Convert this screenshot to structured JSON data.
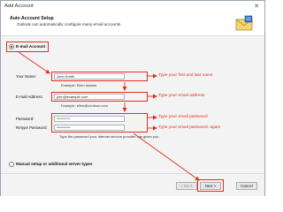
{
  "window": {
    "title": "Add Account",
    "close_glyph": "✕"
  },
  "header": {
    "title": "Auto Account Setup",
    "subtitle": "Outlook can automatically configure many email accounts.",
    "icon": "mail-icon"
  },
  "options": {
    "email_account": "E-mail Account",
    "manual_setup": "Manual setup or additional server types"
  },
  "form": {
    "name_label": "Your Name:",
    "name_value": "John Smith",
    "name_example": "Example: Ellen Adams",
    "email_label": "E-mail Address:",
    "email_value": "john@example.com",
    "email_example": "Example: ellen@contoso.com",
    "password_label": "Password:",
    "password_value": "**********",
    "retype_label": "Retype Password:",
    "retype_value": "**********",
    "password_help": "Type the password your Internet service provider has given you."
  },
  "annotations": {
    "name": "Type your first and last name",
    "email": "Type your email address",
    "password": "Type your email password",
    "retype": "Type your email password, again"
  },
  "footer": {
    "back_label": "< Back",
    "next_label": "Next >",
    "cancel_label": "Cancel"
  },
  "colors": {
    "annotation": "#e0301e",
    "window_border": "#9aa6b4"
  }
}
